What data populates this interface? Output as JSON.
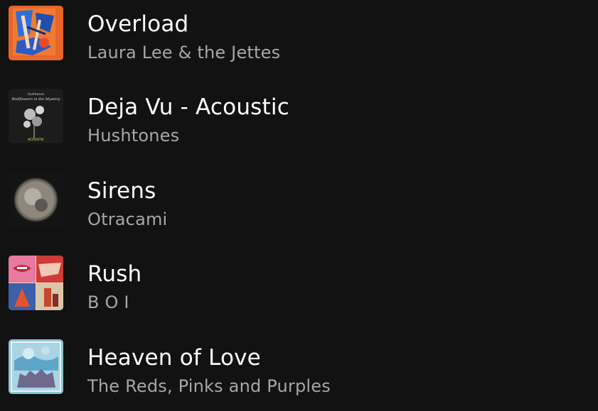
{
  "tracks": [
    {
      "title": "Overload",
      "artist": "Laura Lee & the Jettes",
      "cover_icon": "album-art-overload"
    },
    {
      "title": "Deja Vu - Acoustic",
      "artist": "Hushtones",
      "cover_icon": "album-art-deja-vu",
      "cover_text": [
        "Hushtones",
        "Wallflowers in the Mystery",
        "ACOUSTIC"
      ]
    },
    {
      "title": "Sirens",
      "artist": "Otracami",
      "cover_icon": "album-art-sirens"
    },
    {
      "title": "Rush",
      "artist": "B O I",
      "cover_icon": "album-art-rush"
    },
    {
      "title": "Heaven of Love",
      "artist": "The Reds, Pinks and Purples",
      "cover_icon": "album-art-heaven-of-love"
    }
  ],
  "colors": {
    "background": "#121212",
    "title": "#ffffff",
    "artist": "#a7a7a7"
  }
}
